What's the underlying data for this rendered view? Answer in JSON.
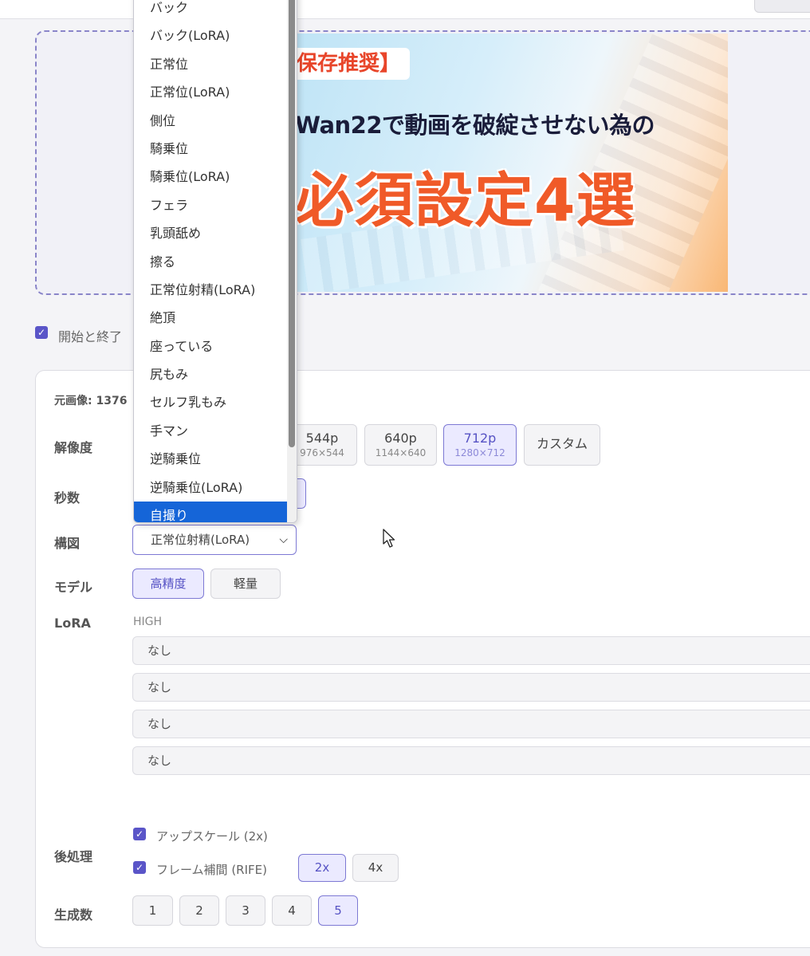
{
  "banner": {
    "tag": "保存推奨】",
    "line1": "Wan22で動画を破綻させない為の",
    "line2": "必須設定4選"
  },
  "start_end_checkbox": {
    "label": "開始と終了",
    "checked": true
  },
  "panel": {
    "source_image_label": "元画像: 1376",
    "resolution": {
      "label": "解像度",
      "options": [
        {
          "main": "544p",
          "sub": "976×544",
          "active": false
        },
        {
          "main": "640p",
          "sub": "1144×640",
          "active": false
        },
        {
          "main": "712p",
          "sub": "1280×712",
          "active": true
        }
      ],
      "custom_label": "カスタム"
    },
    "seconds": {
      "label": "秒数"
    },
    "composition": {
      "label": "構図",
      "selected": "正常位射精(LoRA)"
    },
    "model": {
      "label": "モデル",
      "options": [
        "高精度",
        "軽量"
      ],
      "active_index": 0
    },
    "lora": {
      "label": "LoRA",
      "high_label": "HIGH",
      "fields": [
        "なし",
        "なし",
        "なし",
        "なし"
      ]
    },
    "post": {
      "label": "後処理",
      "upscale": {
        "label": "アップスケール (2x)",
        "checked": true
      },
      "interp": {
        "label": "フレーム補間 (RIFE)",
        "checked": true,
        "options": [
          "2x",
          "4x"
        ],
        "active_index": 0
      }
    },
    "count": {
      "label": "生成数",
      "options": [
        "1",
        "2",
        "3",
        "4",
        "5"
      ],
      "active_index": 4
    }
  },
  "dropdown": {
    "items": [
      "バック",
      "バック(LoRA)",
      "正常位",
      "正常位(LoRA)",
      "側位",
      "騎乗位",
      "騎乗位(LoRA)",
      "フェラ",
      "乳頭舐め",
      "擦る",
      "正常位射精(LoRA)",
      "絶頂",
      "座っている",
      "尻もみ",
      "セルフ乳もみ",
      "手マン",
      "逆騎乗位",
      "逆騎乗位(LoRA)",
      "自撮り"
    ],
    "selected_index": 18
  },
  "colors": {
    "accent": "#5a55c8",
    "accent_bg": "#ebeaff",
    "select_highlight": "#1565d8",
    "dashed_border": "#8a85c9",
    "banner_orange": "#f05a28"
  }
}
